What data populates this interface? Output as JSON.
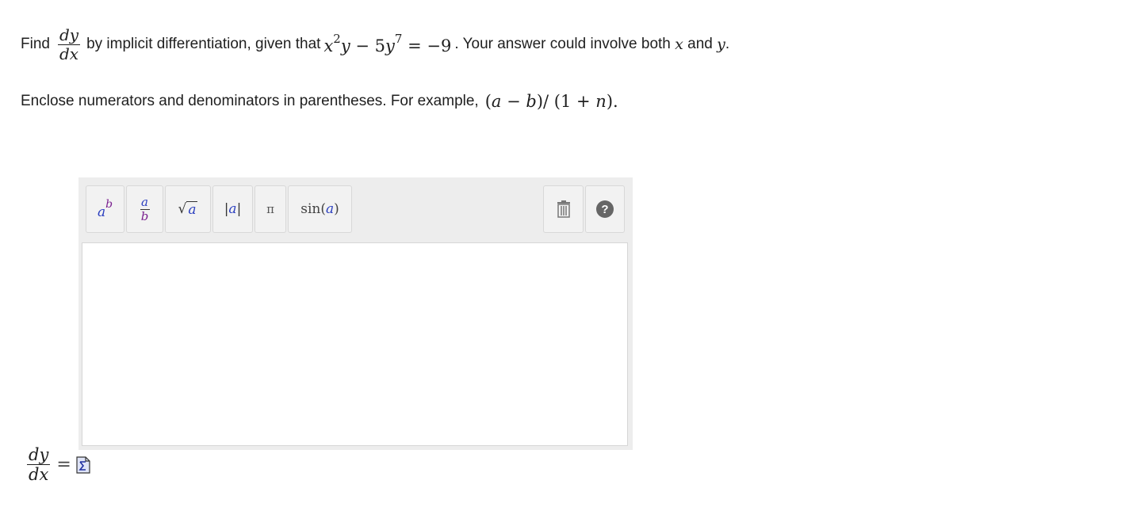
{
  "question": {
    "find_label": "Find",
    "deriv_num": "dy",
    "deriv_den": "dx",
    "text_mid": "by implicit differentiation, given that",
    "equation": {
      "x_var": "x",
      "x_exp": "2",
      "y_var": "y",
      "minus_five": " − 5",
      "y_var2": "y",
      "y_exp": "7",
      "rhs": " = −9"
    },
    "text_end_a": ". Your answer could involve both",
    "var_x": "x",
    "text_and": "and",
    "var_y": "y",
    "period": "."
  },
  "instruction": {
    "text": "Enclose numerators and denominators in parentheses. For example,",
    "example": "(a − b)/ (1 + n).",
    "example_parts": {
      "open": "(",
      "a": "a",
      "minus": " − ",
      "b": "b",
      "close_slash": ")/ (1 + ",
      "n": "n",
      "end": ")."
    }
  },
  "toolbar": {
    "exp_base": "a",
    "exp_power": "b",
    "frac_num": "a",
    "frac_den": "b",
    "sqrt_symbol": "√",
    "sqrt_arg": "a",
    "abs_open": "|",
    "abs_arg": "a",
    "abs_close": "|",
    "pi": "π",
    "sin_fn": "sin",
    "sin_open": " (",
    "sin_arg": "a",
    "sin_close": ")",
    "help": "?"
  },
  "answer": {
    "num": "dy",
    "den": "dx",
    "equals": "="
  },
  "colors": {
    "accent_var": "#2b3fbf",
    "accent_power": "#7a1f8f",
    "help_bg": "#666666"
  }
}
